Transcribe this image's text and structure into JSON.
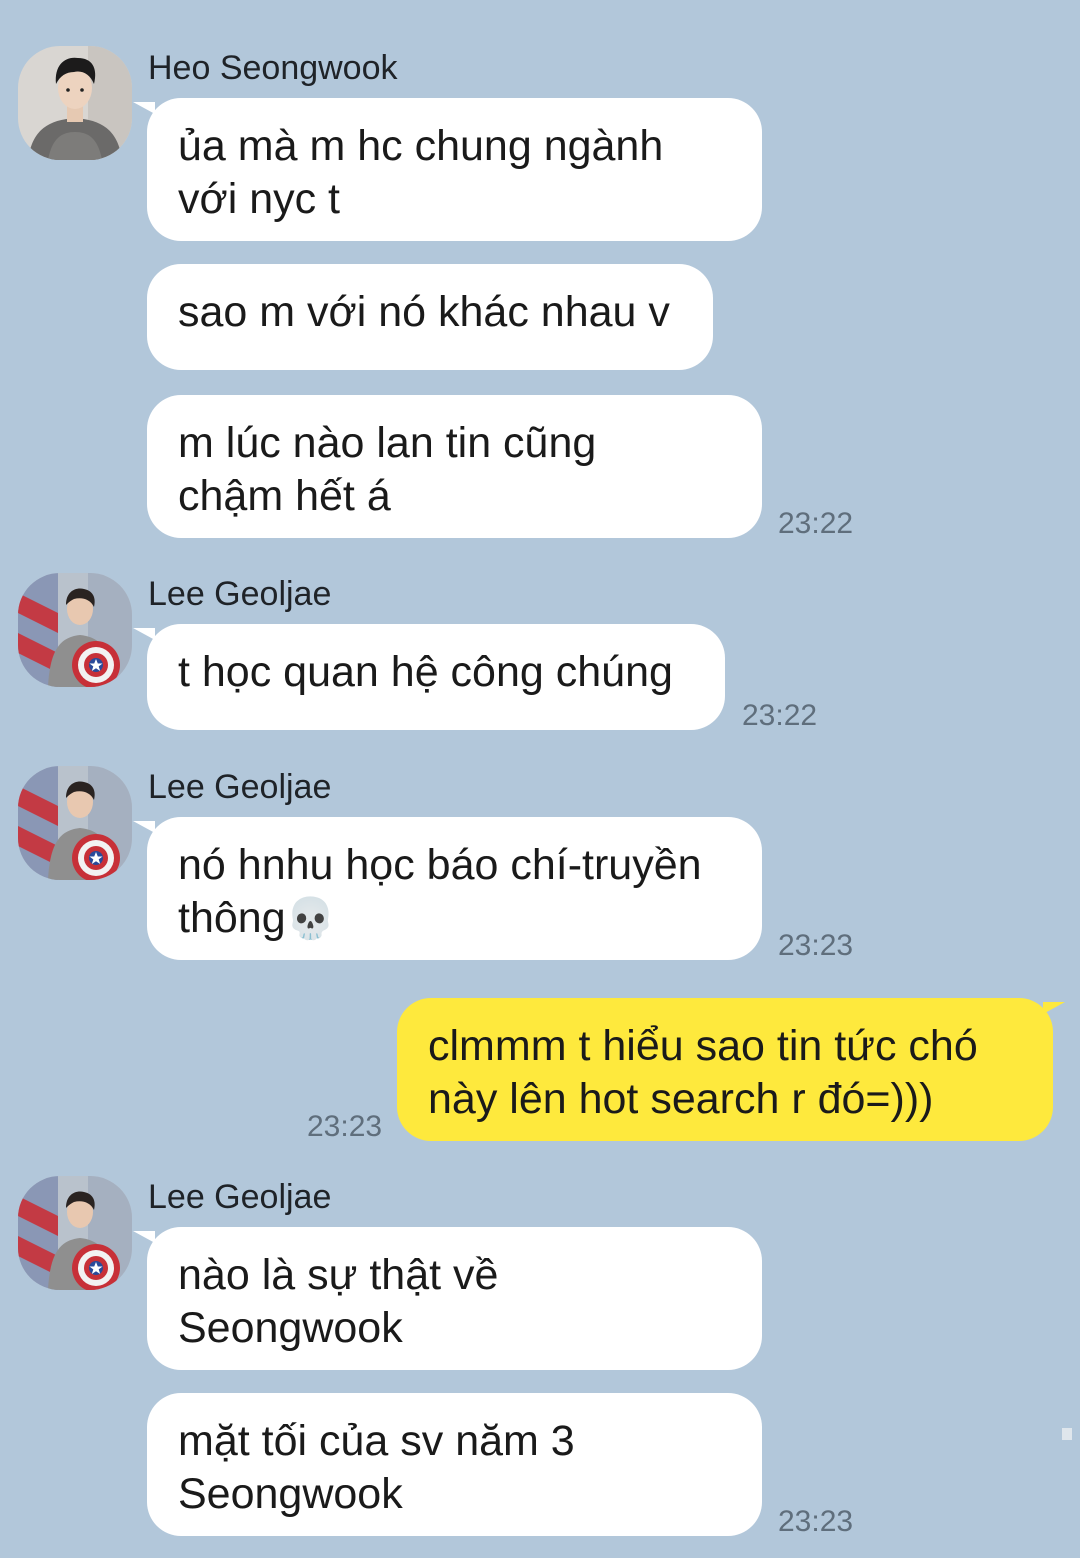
{
  "colors": {
    "background": "#b2c7da",
    "incoming_bubble": "#ffffff",
    "outgoing_bubble": "#fee93d",
    "timestamp": "#5f6e7c"
  },
  "messages": [
    {
      "sender": "Heo Seongwook",
      "avatar": "person-in-grey-sweater-photo",
      "bubbles": [
        {
          "lines": [
            "ủa mà m hc chung ngành",
            "với nyc t"
          ]
        },
        {
          "lines": [
            "sao m với nó khác nhau v"
          ]
        },
        {
          "lines": [
            "m lúc nào lan tin cũng",
            "chậm hết á"
          ]
        }
      ],
      "time": "23:22"
    },
    {
      "sender": "Lee Geoljae",
      "avatar": "person-with-shield-photo",
      "bubbles": [
        {
          "lines": [
            "t học quan hệ công chúng"
          ]
        }
      ],
      "time": "23:22"
    },
    {
      "sender": "Lee Geoljae",
      "avatar": "person-with-shield-photo",
      "bubbles": [
        {
          "lines": [
            "nó hnhu học báo chí-truyền",
            "thông"
          ],
          "emoji": "💀"
        }
      ],
      "time": "23:23"
    },
    {
      "sender": "me",
      "bubbles": [
        {
          "lines": [
            "clmmm t hiểu sao tin tức chó",
            "này lên hot search r đó=)))"
          ]
        }
      ],
      "time": "23:23"
    },
    {
      "sender": "Lee Geoljae",
      "avatar": "person-with-shield-photo",
      "bubbles": [
        {
          "lines": [
            "nào là sự thật về",
            "Seongwook"
          ]
        },
        {
          "lines": [
            "mặt tối của sv năm 3",
            "Seongwook"
          ]
        }
      ],
      "time": "23:23"
    }
  ]
}
